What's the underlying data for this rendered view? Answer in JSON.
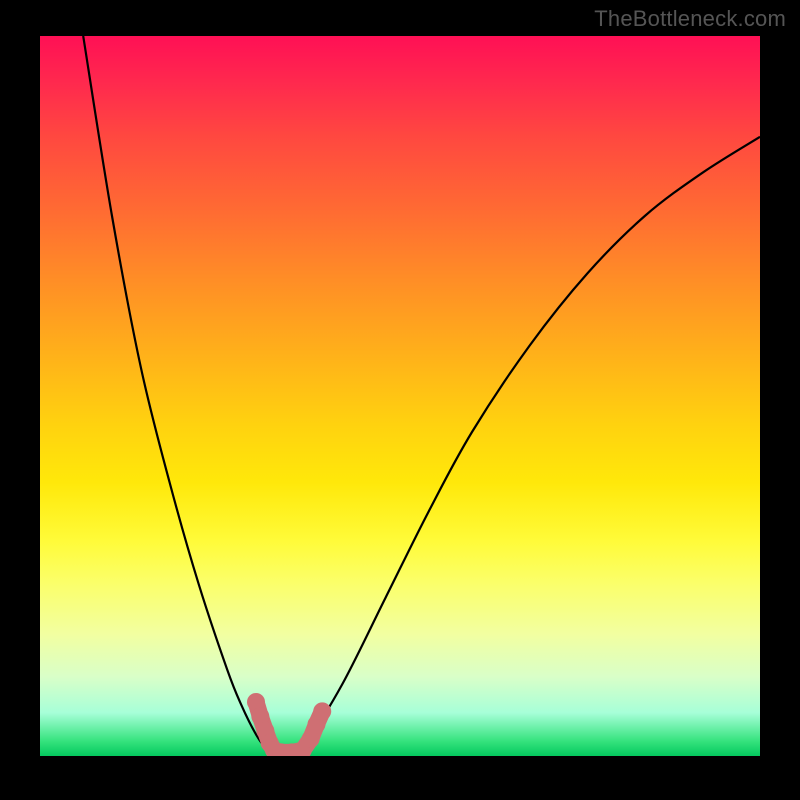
{
  "watermark": "TheBottleneck.com",
  "chart_data": {
    "type": "line",
    "title": "",
    "xlabel": "",
    "ylabel": "",
    "xlim": [
      0,
      100
    ],
    "ylim": [
      0,
      100
    ],
    "grid": false,
    "legend": false,
    "series": [
      {
        "name": "curve",
        "x": [
          6,
          10,
          14,
          18,
          22,
          26,
          28,
          30,
          31.5,
          33,
          35,
          37,
          42,
          48,
          54,
          60,
          68,
          76,
          84,
          92,
          100
        ],
        "y": [
          100,
          75,
          54,
          38,
          24,
          12,
          7,
          3,
          1,
          0.5,
          0.5,
          2,
          10,
          22,
          34,
          45,
          57,
          67,
          75,
          81,
          86
        ]
      }
    ],
    "markers": {
      "note": "salmon rounded markers near the curve minimum",
      "points": [
        {
          "x": 30.0,
          "y": 7.5
        },
        {
          "x": 30.6,
          "y": 5.5
        },
        {
          "x": 31.3,
          "y": 3.5
        },
        {
          "x": 31.9,
          "y": 1.8
        },
        {
          "x": 32.5,
          "y": 0.8
        },
        {
          "x": 33.5,
          "y": 0.5
        },
        {
          "x": 35.0,
          "y": 0.5
        },
        {
          "x": 36.5,
          "y": 0.8
        },
        {
          "x": 37.6,
          "y": 2.4
        },
        {
          "x": 38.4,
          "y": 4.4
        },
        {
          "x": 39.2,
          "y": 6.2
        }
      ]
    },
    "background_gradient": {
      "orientation": "vertical",
      "stops": [
        {
          "pos": 0.0,
          "color": "#ff1055"
        },
        {
          "pos": 0.5,
          "color": "#ffd20f"
        },
        {
          "pos": 0.8,
          "color": "#f8ff90"
        },
        {
          "pos": 1.0,
          "color": "#04c85e"
        }
      ]
    }
  }
}
